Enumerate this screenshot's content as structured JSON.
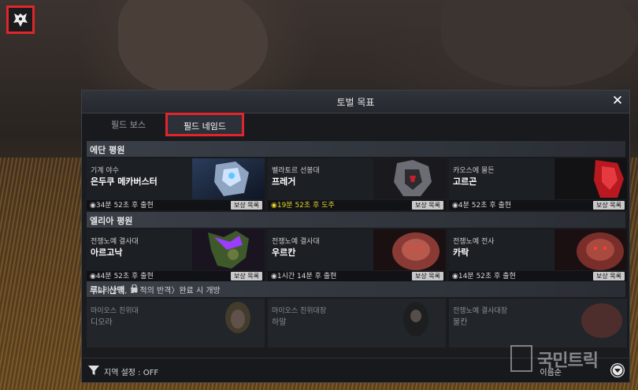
{
  "window": {
    "title": "토벌 목표",
    "close_glyph": "✕"
  },
  "tabs": [
    {
      "label": "필드 보스",
      "selected": false
    },
    {
      "label": "필드 네임드",
      "selected": true
    }
  ],
  "regions": [
    {
      "name": "에단 평원",
      "locked": false,
      "cards": [
        {
          "category": "기계 야수",
          "name": "은두쿠 메카버스터",
          "time": "34분 52초 후 출현",
          "highlight": false,
          "reward": "보상 목록"
        },
        {
          "category": "벨라토르 선봉대",
          "name": "프레거",
          "time": "19분 52초 후 도주",
          "highlight": true,
          "reward": "보상 목록"
        },
        {
          "category": "카오스에 물든",
          "name": "고르곤",
          "time": "4분 52초 후 출현",
          "highlight": false,
          "reward": "보상 목록"
        }
      ]
    },
    {
      "name": "엘리아 평원",
      "locked": false,
      "cards": [
        {
          "category": "전쟁노예 결사대",
          "name": "아르고낙",
          "time": "44분 52초 후 출현",
          "highlight": false,
          "reward": "보상 목록"
        },
        {
          "category": "전쟁노예 결사대",
          "name": "우르칸",
          "time": "1시간 14분 후 출현",
          "highlight": false,
          "reward": "보상 목록"
        },
        {
          "category": "전쟁노예 전사",
          "name": "카락",
          "time": "14분 52초 후 출현",
          "highlight": false,
          "reward": "보상 목록"
        }
      ]
    },
    {
      "name": "루나 산맥",
      "locked": true,
      "requirement": "〈2막 2장, 1. 적의 반격〉완료 시 개방",
      "cards": [
        {
          "category": "마이오스 친위대",
          "name": "디오라"
        },
        {
          "category": "마이오스 친위대장",
          "name": "하말"
        },
        {
          "category": "전쟁노예 결사대장",
          "name": "불칸"
        }
      ]
    }
  ],
  "bottom": {
    "filter_label": "지역 설정 : OFF",
    "sort_label": "이름순"
  },
  "icons": {
    "corner": "character-emblem-icon",
    "filter": "funnel-icon",
    "sort": "circle-down-arrow-icon",
    "lock": "lock-icon",
    "time": "clock-flame-icon"
  },
  "watermark": {
    "text": "국민트릭"
  },
  "colors": {
    "highlight_time": "#e6d52a",
    "annotation_box": "#e0252b",
    "panel_bg": "#181a1e"
  }
}
